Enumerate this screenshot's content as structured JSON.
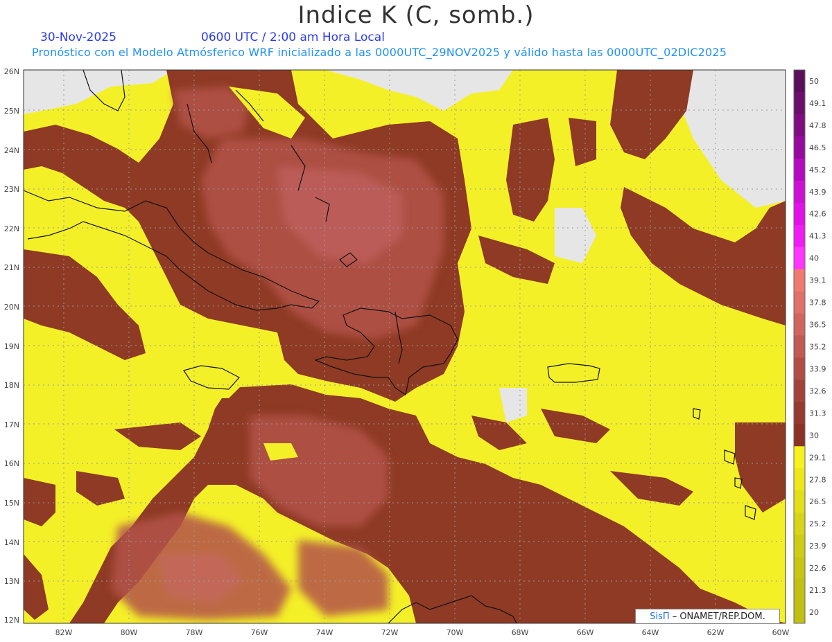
{
  "header": {
    "title": "Indice K (C, somb.)",
    "date": "30-Nov-2025",
    "time": "0600 UTC / 2:00 am Hora Local",
    "forecast": "Pronóstico con el Modelo Atmósferico WRF inicializado a las 0000UTC_29NOV2025 y válido hasta las  0000UTC_02DIC2025"
  },
  "map": {
    "lat_labels": [
      "26N",
      "25N",
      "24N",
      "23N",
      "22N",
      "21N",
      "20N",
      "19N",
      "18N",
      "17N",
      "16N",
      "15N",
      "14N",
      "13N",
      "12N"
    ],
    "lon_labels": [
      "82W",
      "80W",
      "78W",
      "76W",
      "74W",
      "72W",
      "70W",
      "68W",
      "66W",
      "64W",
      "62W",
      "60W"
    ],
    "colors": {
      "yellow": "#f4f028",
      "land_gray": "#e6e6e6",
      "dark_brown": "#8e3a24",
      "mid_brown": "#a5483a",
      "light_brown": "#c0605a"
    }
  },
  "colorbar": {
    "labels": [
      "50",
      "49.1",
      "47.8",
      "46.5",
      "45.2",
      "43.9",
      "42.6",
      "41.3",
      "40",
      "39.1",
      "37.8",
      "36.5",
      "35.2",
      "33.9",
      "32.6",
      "31.3",
      "30",
      "29.1",
      "27.8",
      "26.5",
      "25.2",
      "23.9",
      "22.6",
      "21.3",
      "20"
    ],
    "colors": [
      "#5a0f5a",
      "#6c0f6c",
      "#7e0d80",
      "#960a9e",
      "#b40ac0",
      "#cd10d4",
      "#e012e6",
      "#f01cf4",
      "#ff36ff",
      "#f07a70",
      "#e0706a",
      "#d06560",
      "#c05a52",
      "#b04e44",
      "#a14338",
      "#953a2e",
      "#8a3224",
      "#f6f21e",
      "#ece81a",
      "#e2de18",
      "#d8d416",
      "#cfcc14",
      "#c8c614",
      "#c2c014",
      "#c0c010"
    ]
  },
  "credit": {
    "logo": "SisΠ",
    "text": "– ONAMET/REP.DOM."
  }
}
